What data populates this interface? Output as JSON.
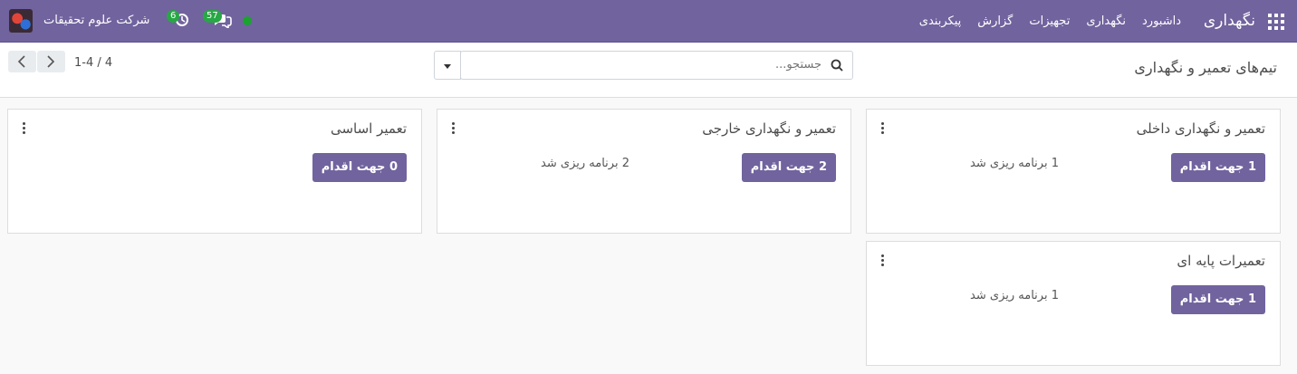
{
  "navbar": {
    "brand": "نگهداری",
    "menu": [
      "داشبورد",
      "نگهداری",
      "تجهیزات",
      "گزارش",
      "پیکربندی"
    ],
    "company": "شرکت علوم تحقیقات",
    "chat_badge": "57",
    "activity_badge": "6",
    "accent_color": "#71639e",
    "status_color": "#1aa32f"
  },
  "control": {
    "title": "تیم‌های تعمیر و نگهداری",
    "search_placeholder": "جستجو...",
    "pager": "1-4 / 4"
  },
  "teams": [
    {
      "name": "تعمیر و نگهداری داخلی",
      "button": "1 جهت اقدام",
      "planned": "1 برنامه ریزی شد"
    },
    {
      "name": "تعمیر و نگهداری خارجی",
      "button": "2 جهت اقدام",
      "planned": "2 برنامه ریزی شد"
    },
    {
      "name": "تعمیر اساسی",
      "button": "0 جهت اقدام",
      "planned": ""
    },
    {
      "name": "تعمیرات پایه ای",
      "button": "1 جهت اقدام",
      "planned": "1 برنامه ریزی شد"
    }
  ]
}
